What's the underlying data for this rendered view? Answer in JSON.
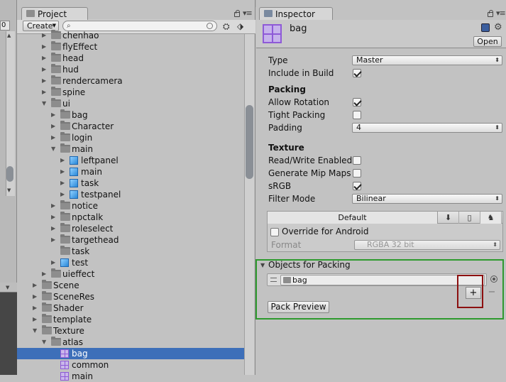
{
  "left_strip": {
    "field_value": "0"
  },
  "project": {
    "tab_title": "Project",
    "create_label": "Create",
    "tree": [
      {
        "label": "chenhao",
        "depth": 2,
        "icon": "folder",
        "expand": "collapsed"
      },
      {
        "label": "flyEffect",
        "depth": 2,
        "icon": "folder",
        "expand": "collapsed"
      },
      {
        "label": "head",
        "depth": 2,
        "icon": "folder",
        "expand": "collapsed"
      },
      {
        "label": "hud",
        "depth": 2,
        "icon": "folder",
        "expand": "collapsed"
      },
      {
        "label": "rendercamera",
        "depth": 2,
        "icon": "folder",
        "expand": "collapsed"
      },
      {
        "label": "spine",
        "depth": 2,
        "icon": "folder",
        "expand": "collapsed"
      },
      {
        "label": "ui",
        "depth": 2,
        "icon": "folder",
        "expand": "expanded"
      },
      {
        "label": "bag",
        "depth": 3,
        "icon": "folder",
        "expand": "collapsed"
      },
      {
        "label": "Character",
        "depth": 3,
        "icon": "folder",
        "expand": "collapsed"
      },
      {
        "label": "login",
        "depth": 3,
        "icon": "folder",
        "expand": "collapsed"
      },
      {
        "label": "main",
        "depth": 3,
        "icon": "folder",
        "expand": "expanded"
      },
      {
        "label": "leftpanel",
        "depth": 4,
        "icon": "prefab",
        "expand": "collapsed"
      },
      {
        "label": "main",
        "depth": 4,
        "icon": "prefab",
        "expand": "collapsed"
      },
      {
        "label": "task",
        "depth": 4,
        "icon": "prefab",
        "expand": "collapsed"
      },
      {
        "label": "testpanel",
        "depth": 4,
        "icon": "prefab",
        "expand": "collapsed"
      },
      {
        "label": "notice",
        "depth": 3,
        "icon": "folder",
        "expand": "collapsed"
      },
      {
        "label": "npctalk",
        "depth": 3,
        "icon": "folder",
        "expand": "collapsed"
      },
      {
        "label": "roleselect",
        "depth": 3,
        "icon": "folder",
        "expand": "collapsed"
      },
      {
        "label": "targethead",
        "depth": 3,
        "icon": "folder",
        "expand": "collapsed"
      },
      {
        "label": "task",
        "depth": 3,
        "icon": "folder",
        "expand": "none"
      },
      {
        "label": "test",
        "depth": 3,
        "icon": "prefab",
        "expand": "collapsed"
      },
      {
        "label": "uieffect",
        "depth": 2,
        "icon": "folder",
        "expand": "collapsed"
      },
      {
        "label": "Scene",
        "depth": 1,
        "icon": "folder",
        "expand": "collapsed"
      },
      {
        "label": "SceneRes",
        "depth": 1,
        "icon": "folder",
        "expand": "collapsed"
      },
      {
        "label": "Shader",
        "depth": 1,
        "icon": "folder",
        "expand": "collapsed"
      },
      {
        "label": "template",
        "depth": 1,
        "icon": "folder",
        "expand": "collapsed"
      },
      {
        "label": "Texture",
        "depth": 1,
        "icon": "folder",
        "expand": "expanded"
      },
      {
        "label": "atlas",
        "depth": 2,
        "icon": "folder",
        "expand": "expanded"
      },
      {
        "label": "bag",
        "depth": 3,
        "icon": "atlas",
        "expand": "none",
        "selected": true
      },
      {
        "label": "common",
        "depth": 3,
        "icon": "atlas",
        "expand": "none"
      },
      {
        "label": "main",
        "depth": 3,
        "icon": "atlas",
        "expand": "none"
      }
    ]
  },
  "inspector": {
    "tab_title": "Inspector",
    "asset_name": "bag",
    "open_label": "Open",
    "type_label": "Type",
    "type_value": "Master",
    "include_label": "Include in Build",
    "packing_header": "Packing",
    "allow_rotation_label": "Allow Rotation",
    "tight_packing_label": "Tight Packing",
    "padding_label": "Padding",
    "padding_value": "4",
    "texture_header": "Texture",
    "read_write_label": "Read/Write Enabled",
    "mipmaps_label": "Generate Mip Maps",
    "srgb_label": "sRGB",
    "filter_label": "Filter Mode",
    "filter_value": "Bilinear",
    "platform_default": "Default",
    "override_label": "Override for Android",
    "format_label": "Format",
    "format_value": "RGBA 32 bit",
    "objects_header": "Objects for Packing",
    "objects": [
      "bag"
    ],
    "add_label": "+",
    "remove_label": "−",
    "pack_preview_label": "Pack Preview",
    "checks": {
      "include": true,
      "allow_rotation": true,
      "tight_packing": false,
      "read_write": false,
      "mipmaps": false,
      "srgb": true,
      "override": false
    }
  },
  "annotation_colors": {
    "green_box": "#2e9a2e",
    "red_box": "#8c1010",
    "selection": "#3d6fb9"
  }
}
